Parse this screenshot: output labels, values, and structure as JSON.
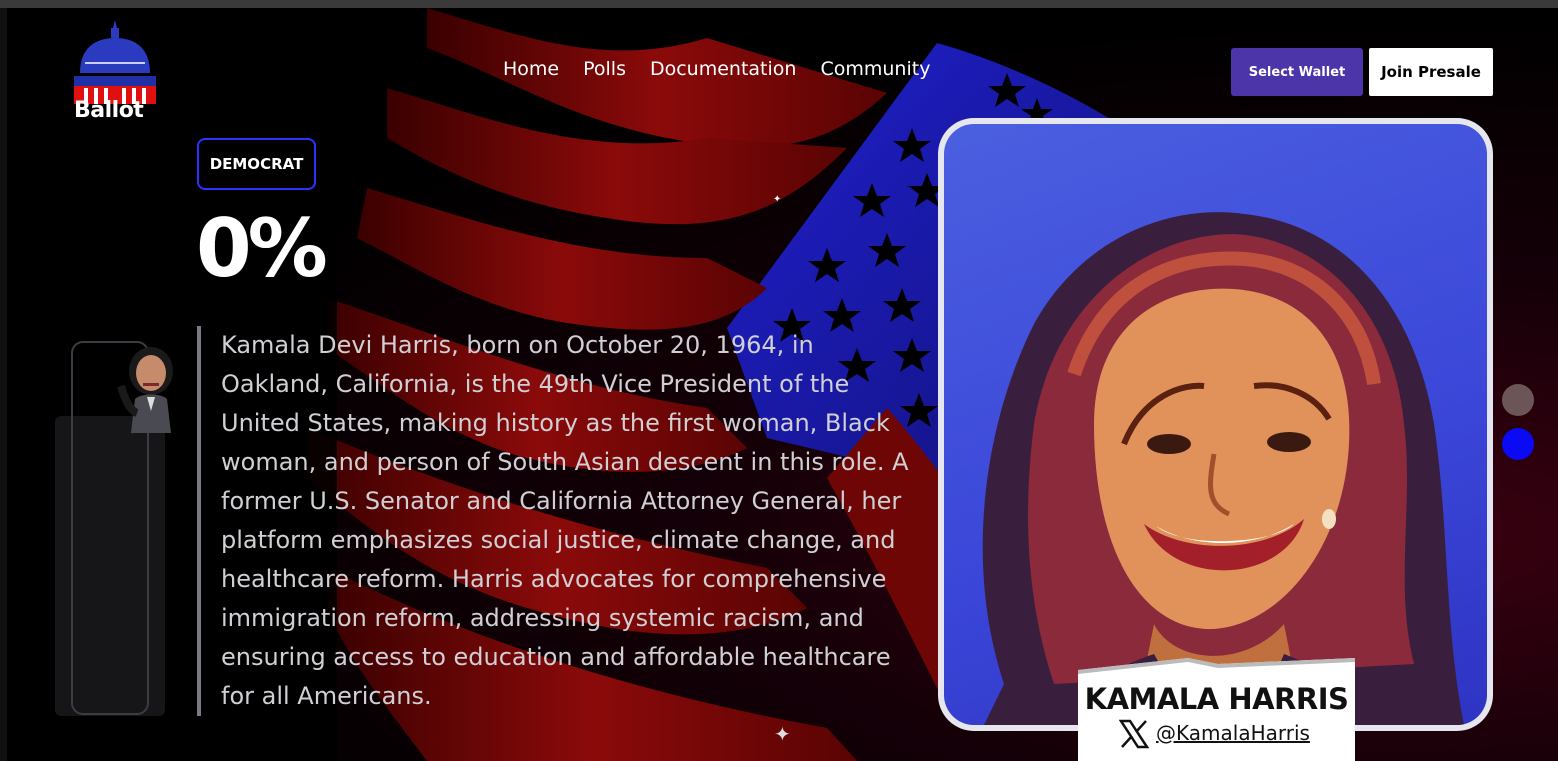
{
  "brand": {
    "name": "Ballot"
  },
  "nav": {
    "items": [
      "Home",
      "Polls",
      "Documentation",
      "Community"
    ]
  },
  "header": {
    "select_wallet_label": "Select Wallet",
    "join_presale_label": "Join Presale"
  },
  "candidate": {
    "party": "DEMOCRAT",
    "vote_share": "0%",
    "vote_share_value": 0,
    "bio": "Kamala Devi Harris, born on October 20, 1964, in Oakland, California, is the 49th Vice President of the United States, making history as the first woman, Black woman, and person of South Asian descent in this role. A former U.S. Senator and California Attorney General, her platform emphasizes social justice, climate change, and healthcare reform. Harris advocates for comprehensive immigration reform, addressing systemic racism, and ensuring access to education and affordable healthcare for all Americans.",
    "name": "KAMALA HARRIS",
    "handle": "@KamalaHarris",
    "social_icon": "x-icon"
  },
  "carousel": {
    "dots": [
      {
        "state": "inactive",
        "color": "#6b5556"
      },
      {
        "state": "active",
        "color": "#0a0af5"
      }
    ]
  },
  "colors": {
    "accent": "#4c35a8",
    "party_border": "#2b33ff",
    "flag_red": "#8b0a0a",
    "flag_blue": "#1d1dbf"
  }
}
